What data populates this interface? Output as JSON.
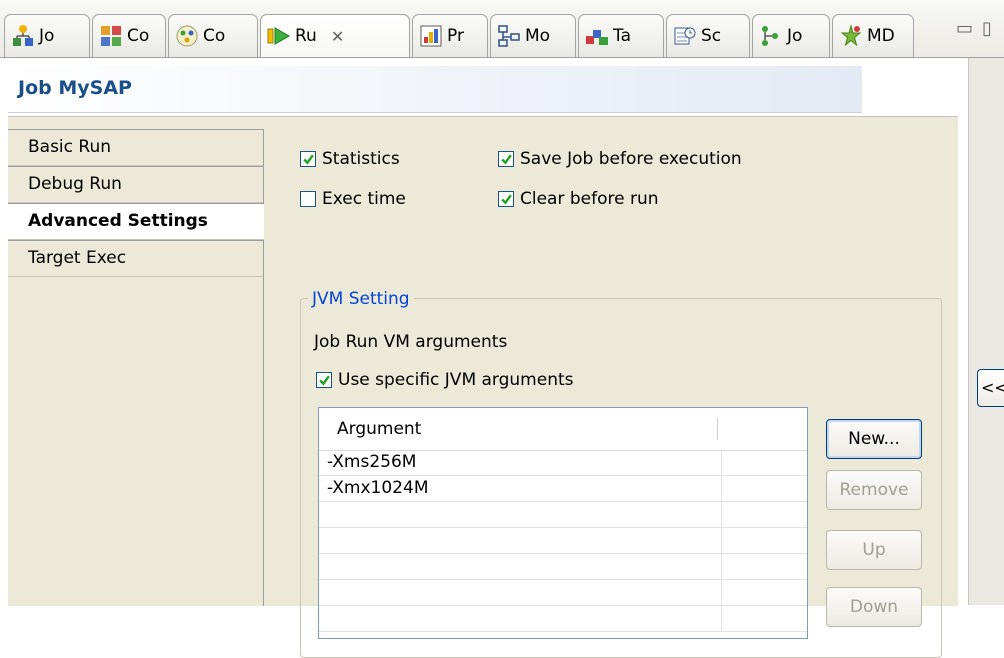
{
  "tabs": [
    {
      "label": "Jo",
      "icon": "job-hierarchy-icon"
    },
    {
      "label": "Co",
      "icon": "component-icon"
    },
    {
      "label": "Co",
      "icon": "contexts-icon"
    },
    {
      "label": "Ru",
      "icon": "run-icon",
      "active": true
    },
    {
      "label": "Pr",
      "icon": "problems-icon"
    },
    {
      "label": "Mo",
      "icon": "modules-icon"
    },
    {
      "label": "Ta",
      "icon": "tasks-icon"
    },
    {
      "label": "Sc",
      "icon": "scheduler-icon"
    },
    {
      "label": "Jo",
      "icon": "job-tree-icon"
    },
    {
      "label": "MD",
      "icon": "metadata-icon"
    }
  ],
  "window": {
    "minimize_glyph": "▭",
    "maximize_glyph": "▯"
  },
  "job_title": "Job MySAP",
  "nav": [
    {
      "label": "Basic Run"
    },
    {
      "label": "Debug Run"
    },
    {
      "label": "Advanced Settings",
      "selected": true
    },
    {
      "label": "Target Exec"
    }
  ],
  "options": {
    "statistics": {
      "label": "Statistics",
      "checked": true
    },
    "exec_time": {
      "label": "Exec time",
      "checked": false
    },
    "save_job": {
      "label": "Save Job before execution",
      "checked": true
    },
    "clear_before_run": {
      "label": "Clear before run",
      "checked": true
    }
  },
  "jvm": {
    "legend": "JVM Setting",
    "vm_args_label": "Job Run VM arguments",
    "use_specific": {
      "label": "Use specific JVM arguments",
      "checked": true
    },
    "table": {
      "column": "Argument",
      "rows": [
        "-Xms256M",
        "-Xmx1024M",
        "",
        "",
        "",
        "",
        ""
      ]
    },
    "buttons": {
      "new": "New...",
      "remove": "Remove",
      "up": "Up",
      "down": "Down"
    }
  },
  "side_panel": {
    "collapse_label": "<<"
  },
  "colors": {
    "panel_bg": "#ece9d8",
    "title_text": "#1b4f8a",
    "legend_text": "#0046d5",
    "checkbox_border": "#1c5180",
    "check_mark": "#21a121"
  }
}
